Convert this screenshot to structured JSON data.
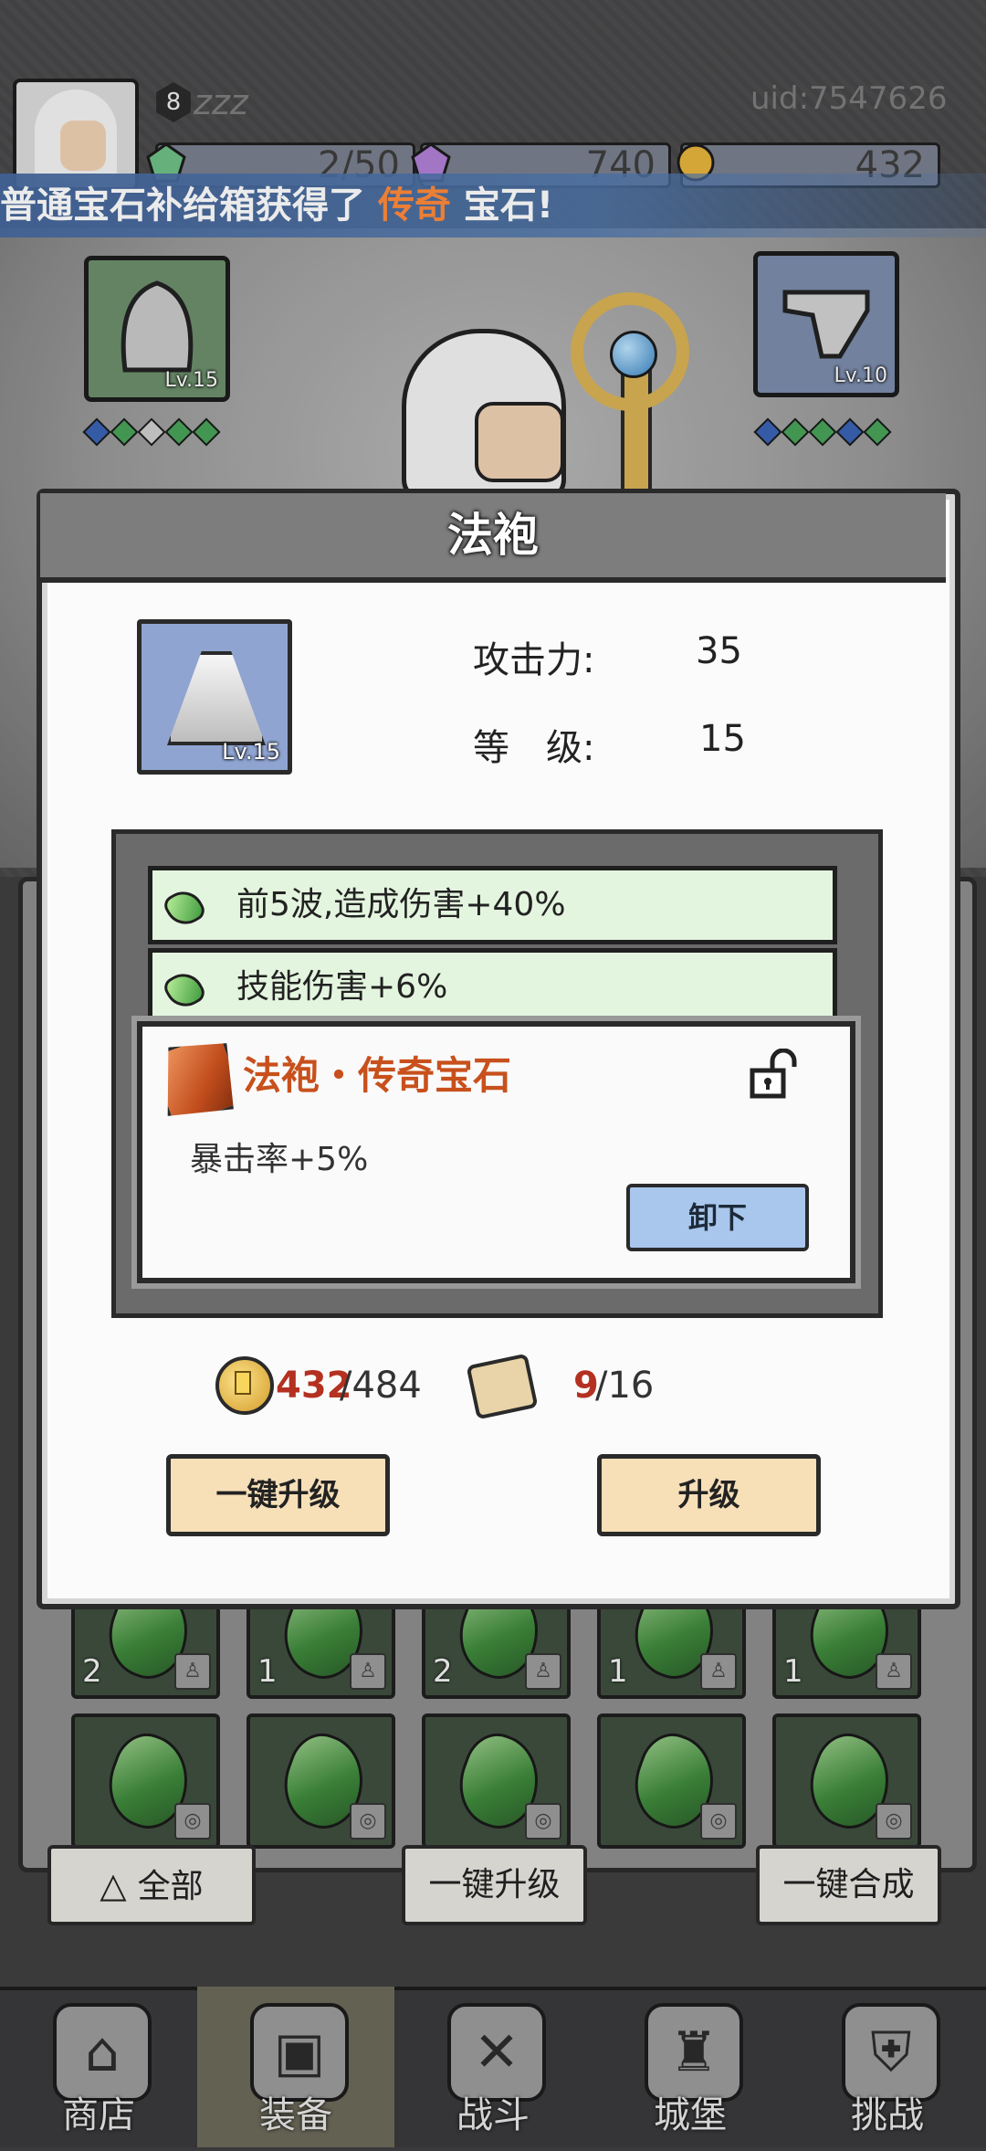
{
  "header": {
    "level": "8",
    "player_name": "zzz",
    "uid": "uid:7547626",
    "resources": [
      {
        "icon": "green-gem-icon",
        "value": "2/50"
      },
      {
        "icon": "purple-gem-icon",
        "value": "740"
      },
      {
        "icon": "gold-coin-icon",
        "value": "432"
      }
    ]
  },
  "banner": {
    "prefix": "普通宝石补给箱获得了",
    "highlight": "传奇",
    "suffix": "宝石!"
  },
  "equipment": {
    "left_slot_level": "Lv.15",
    "right_slot_level": "Lv.10"
  },
  "dialog": {
    "title": "法袍",
    "item_level": "Lv.15",
    "attack_label": "攻击力:",
    "attack_value": "35",
    "level_label": "等　级:",
    "level_value": "15",
    "affixes": [
      {
        "text": "前5波,造成伤害+40%"
      },
      {
        "text": "技能伤害+6%"
      }
    ],
    "legend": {
      "title": "法袍・传奇宝石",
      "effect": "暴击率+5%",
      "unequip_label": "卸下"
    },
    "costs": {
      "coin_have": "432",
      "coin_need": "/484",
      "scroll_have": "9",
      "scroll_need": "/16"
    },
    "buttons": {
      "bulk_upgrade": "一键升级",
      "upgrade": "升级"
    }
  },
  "grid": {
    "row1_counts": [
      "2",
      "1",
      "2",
      "1",
      "1"
    ]
  },
  "toolbar": {
    "all_label": "全部",
    "bulk_upgrade_label": "一键升级",
    "bulk_merge_label": "一键合成"
  },
  "nav": [
    {
      "label": "商店",
      "icon": "shop-icon"
    },
    {
      "label": "装备",
      "icon": "backpack-icon",
      "active": true
    },
    {
      "label": "战斗",
      "icon": "crossed-swords-icon"
    },
    {
      "label": "城堡",
      "icon": "castle-icon"
    },
    {
      "label": "挑战",
      "icon": "locked-shield-icon"
    }
  ],
  "colors": {
    "legendary": "#c8501c",
    "cost_shortfall": "#b43121",
    "affix_bg": "#e4f5df",
    "unequip_button": "#a9c7ec",
    "action_button": "#f7dfb8"
  }
}
